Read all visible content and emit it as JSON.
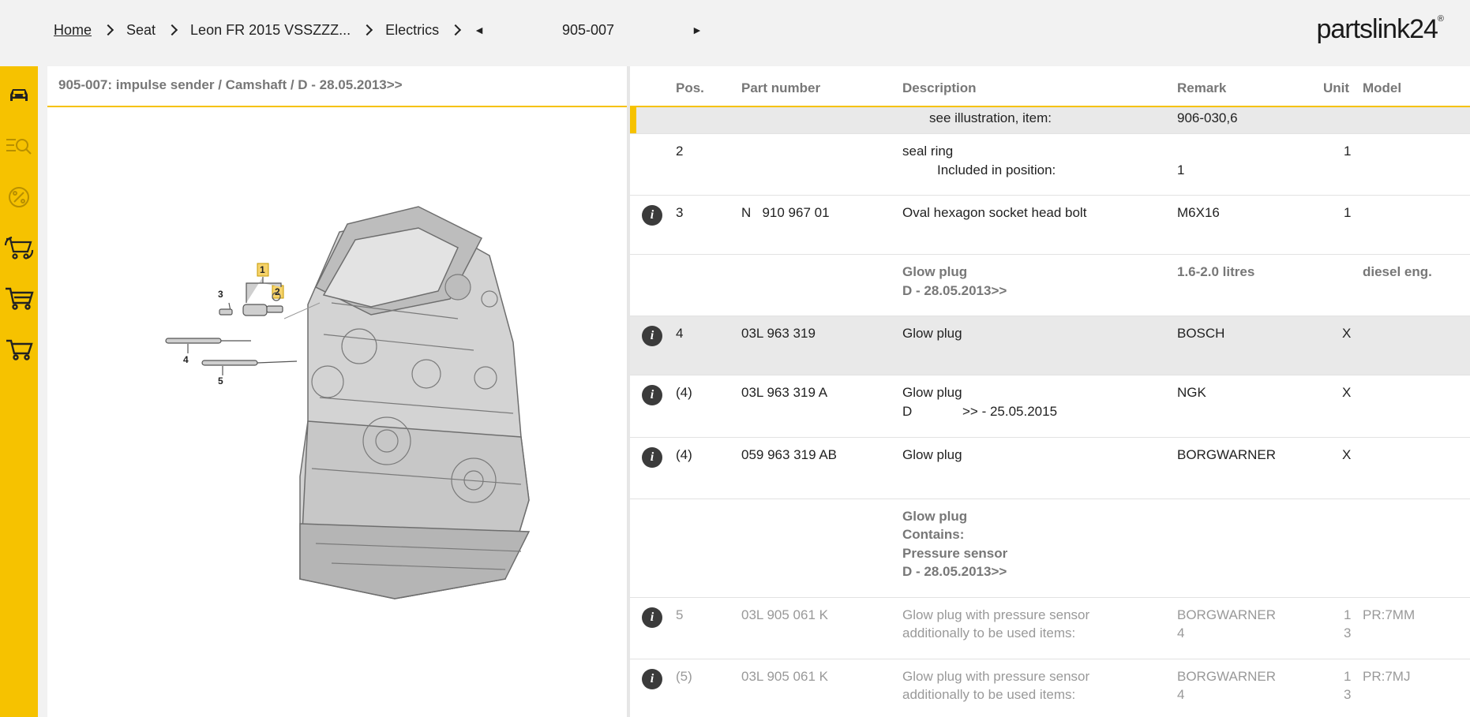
{
  "breadcrumb": {
    "home": "Home",
    "brand": "Seat",
    "vehicle": "Leon FR 2015 VSSZZZ...",
    "category": "Electrics",
    "prev_arrow": "◄",
    "code": "905-007",
    "next_arrow": "►"
  },
  "logo": {
    "text": "partslink24",
    "mark": "®"
  },
  "sidebar": {
    "items": [
      {
        "name": "car-icon"
      },
      {
        "name": "search-list-icon"
      },
      {
        "name": "percent-icon"
      },
      {
        "name": "cart-exchange-icon"
      },
      {
        "name": "cart-icon"
      },
      {
        "name": "cart-outline-icon"
      }
    ]
  },
  "illustration": {
    "title": "905-007: impulse sender / Camshaft / D - 28.05.2013>>",
    "callouts": [
      "1",
      "2",
      "3",
      "4",
      "5"
    ]
  },
  "table": {
    "headers": {
      "pos": "Pos.",
      "part_number": "Part number",
      "description": "Description",
      "remark": "Remark",
      "unit": "Unit",
      "model": "Model"
    },
    "rows": [
      {
        "type": "partial",
        "desc": "see illustration, item:",
        "remark": "906-030,6"
      },
      {
        "pos": "2",
        "part": "",
        "desc": "seal ring",
        "desc2": "Included in position:",
        "remark": "",
        "remark2": "1",
        "unit": "1",
        "model": ""
      },
      {
        "pos": "3",
        "part": "N   910 967 01",
        "desc": "Oval hexagon socket head bolt",
        "remark": "M6X16",
        "unit": "1",
        "model": ""
      },
      {
        "type": "group",
        "desc": "Glow plug",
        "desc2": "D - 28.05.2013>>",
        "remark": "1.6-2.0 litres",
        "model": "diesel eng."
      },
      {
        "pos": "4",
        "part": "03L 963 319",
        "desc": "Glow plug",
        "remark": "BOSCH",
        "unit": "X"
      },
      {
        "pos": "(4)",
        "part": "03L 963 319 A",
        "desc": "Glow plug",
        "desc2_a": "D",
        "desc2_b": ">> - 25.05.2015",
        "remark": "NGK",
        "unit": "X"
      },
      {
        "pos": "(4)",
        "part": "059 963 319 AB",
        "desc": "Glow plug",
        "remark": "BORGWARNER",
        "unit": "X"
      },
      {
        "type": "group",
        "desc": "Glow plug",
        "desc2": "Contains:",
        "desc3": "Pressure sensor",
        "desc4": "D - 28.05.2013>>"
      },
      {
        "pos": "5",
        "part": "03L 905 061 K",
        "desc": "Glow plug with pressure sensor",
        "desc2": "additionally to be used items:",
        "remark": "BORGWARNER",
        "remark2": "4",
        "unit": "1",
        "unit2": "3",
        "model": "PR:7MM"
      },
      {
        "pos": "(5)",
        "part": "03L 905 061 K",
        "desc": "Glow plug with pressure sensor",
        "desc2": "additionally to be used items:",
        "remark": "BORGWARNER",
        "remark2": "4",
        "unit": "1",
        "unit2": "3",
        "model": "PR:7MJ"
      }
    ]
  },
  "colors": {
    "accent": "#f6c200",
    "header_text": "#777777",
    "muted": "#999999"
  }
}
